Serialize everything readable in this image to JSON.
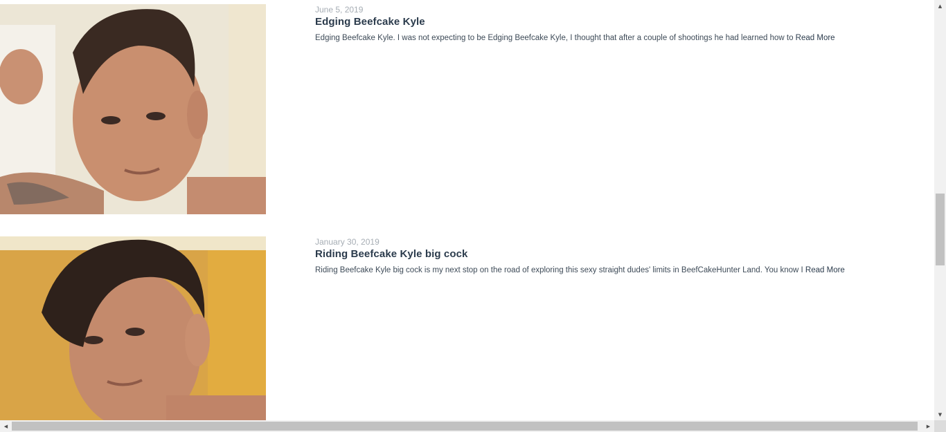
{
  "posts": [
    {
      "date": "June 5, 2019",
      "title": "Edging Beefcake Kyle",
      "excerpt": "Edging Beefcake Kyle. I was not expecting to be Edging Beefcake Kyle, I thought that after a couple of shootings he had learned how to",
      "read_more": "Read More"
    },
    {
      "date": "January 30, 2019",
      "title": "Riding Beefcake Kyle big cock",
      "excerpt": "Riding Beefcake Kyle big cock is my next stop on the road of exploring this sexy straight dudes' limits in BeefCakeHunter Land. You know I",
      "read_more": "Read More"
    }
  ],
  "scrollbars": {
    "up_arrow": "▲",
    "down_arrow": "▼",
    "left_arrow": "◀",
    "right_arrow": "▶"
  }
}
